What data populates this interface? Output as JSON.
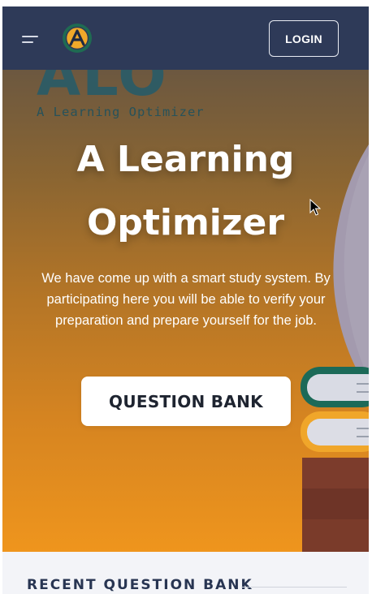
{
  "navbar": {
    "login_label": "LOGIN",
    "logo_icon": "alo-logo-icon",
    "menu_icon": "menu-icon",
    "background": "#2e3a58"
  },
  "hero": {
    "brand_big": "ALO",
    "brand_sub": "A Learning Optimizer",
    "title_line1": "A Learning",
    "title_line2": "Optimizer",
    "description": "We have come up with a smart study system. By participating here you will be able to verify your preparation and prepare yourself for the job.",
    "cta_label": "QUESTION BANK",
    "gradient_top": "#6c5840",
    "gradient_bottom": "#ef951d"
  },
  "recent": {
    "heading": "RECENT QUESTION BANK"
  }
}
